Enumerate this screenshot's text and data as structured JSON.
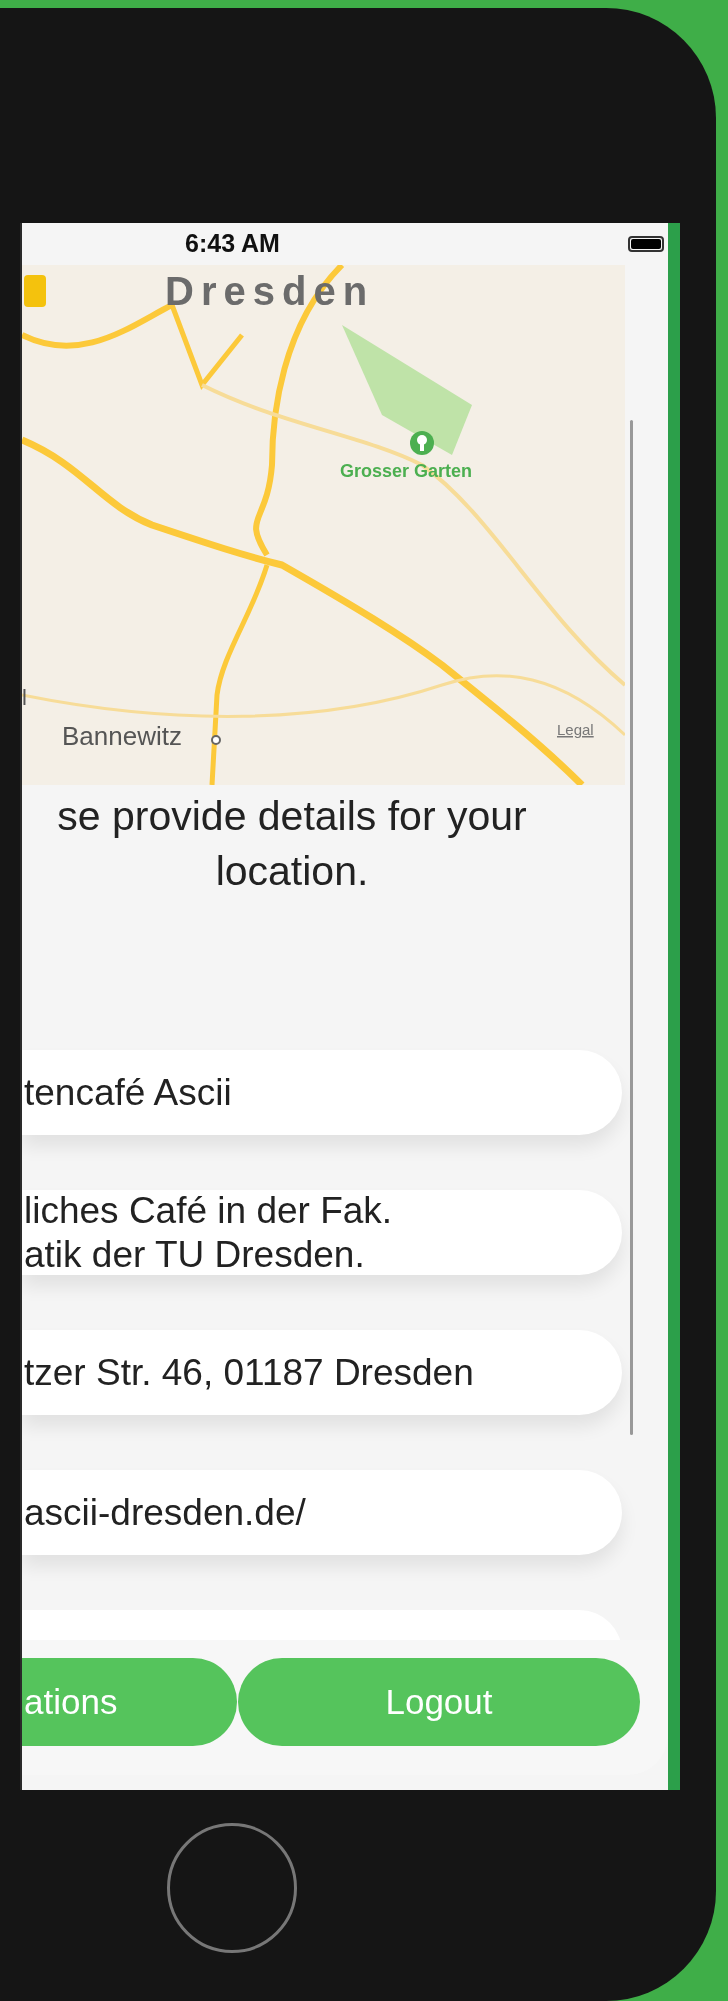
{
  "status_bar": {
    "time": "6:43 AM"
  },
  "map": {
    "labels": [
      {
        "kind": "city",
        "text": "Dresden"
      },
      {
        "kind": "park",
        "text": "Grosser Garten"
      },
      {
        "kind": "town",
        "text": "Bannewitz"
      },
      {
        "kind": "fragment",
        "text": "l"
      }
    ],
    "legal": "Legal"
  },
  "prompt": "se provide details for your location.",
  "fields": [
    {
      "value": "tencafé Ascii"
    },
    {
      "value": "liches Café in der Fak.\natik der TU Dresden."
    },
    {
      "value": "tzer Str. 46, 01187 Dresden"
    },
    {
      "value": "ascii-dresden.de/"
    }
  ],
  "buttons": [
    {
      "label": "ations"
    },
    {
      "label": "Logout"
    }
  ]
}
